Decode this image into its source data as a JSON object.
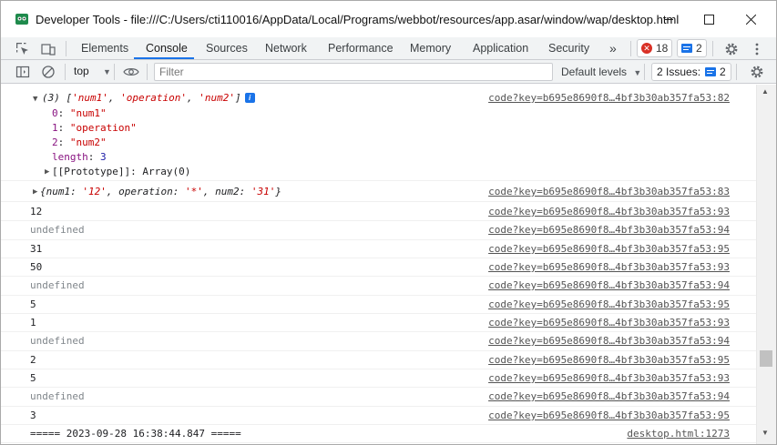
{
  "window": {
    "title": "Developer Tools - file:///C:/Users/cti110016/AppData/Local/Programs/webbot/resources/app.asar/window/wap/desktop.html"
  },
  "tabs": [
    {
      "label": "Elements"
    },
    {
      "label": "Console"
    },
    {
      "label": "Sources"
    },
    {
      "label": "Network"
    },
    {
      "label": "Performance"
    },
    {
      "label": "Memory"
    },
    {
      "label": "Application"
    },
    {
      "label": "Security"
    }
  ],
  "more_tabs": "»",
  "badges": {
    "errors": "18",
    "messages": "2"
  },
  "toolbar": {
    "context": "top",
    "filter_placeholder": "Filter",
    "levels_label": "Default levels",
    "issues_label": "2 Issues:",
    "issues_count": "2"
  },
  "console": {
    "array_head": {
      "prefix": "(3) [",
      "items": [
        "'num1'",
        "'operation'",
        "'num2'"
      ],
      "suffix": "]",
      "source": "code?key=b695e8690f8…4bf3b30ab357fa53:82"
    },
    "array_children": [
      {
        "key": "0",
        "value": "\"num1\""
      },
      {
        "key": "1",
        "value": "\"operation\""
      },
      {
        "key": "2",
        "value": "\"num2\""
      }
    ],
    "length_key": "length",
    "length_value": "3",
    "prototype": "[[Prototype]]: Array(0)",
    "object_row": {
      "open": "{",
      "k1": "num1",
      "v1": "'12'",
      "k2": "operation",
      "v2": "'*'",
      "k3": "num2",
      "v3": "'31'",
      "close": "}",
      "source": "code?key=b695e8690f8…4bf3b30ab357fa53:83"
    },
    "rows": [
      {
        "text": "12",
        "source": "code?key=b695e8690f8…4bf3b30ab357fa53:93"
      },
      {
        "text": "undefined",
        "source": "code?key=b695e8690f8…4bf3b30ab357fa53:94"
      },
      {
        "text": "31",
        "source": "code?key=b695e8690f8…4bf3b30ab357fa53:95"
      },
      {
        "text": "50",
        "source": "code?key=b695e8690f8…4bf3b30ab357fa53:93"
      },
      {
        "text": "undefined",
        "source": "code?key=b695e8690f8…4bf3b30ab357fa53:94"
      },
      {
        "text": "5",
        "source": "code?key=b695e8690f8…4bf3b30ab357fa53:95"
      },
      {
        "text": "1",
        "source": "code?key=b695e8690f8…4bf3b30ab357fa53:93"
      },
      {
        "text": "undefined",
        "source": "code?key=b695e8690f8…4bf3b30ab357fa53:94"
      },
      {
        "text": "2",
        "source": "code?key=b695e8690f8…4bf3b30ab357fa53:95"
      },
      {
        "text": "5",
        "source": "code?key=b695e8690f8…4bf3b30ab357fa53:93"
      },
      {
        "text": "undefined",
        "source": "code?key=b695e8690f8…4bf3b30ab357fa53:94"
      },
      {
        "text": "3",
        "source": "code?key=b695e8690f8…4bf3b30ab357fa53:95"
      }
    ],
    "last_row": {
      "text": "===== 2023-09-28 16:38:44.847 =====",
      "source": "desktop.html:1273"
    }
  },
  "colors": {
    "accent": "#1a73e8",
    "error": "#d93025",
    "string": "#c80000",
    "key": "#881280"
  }
}
